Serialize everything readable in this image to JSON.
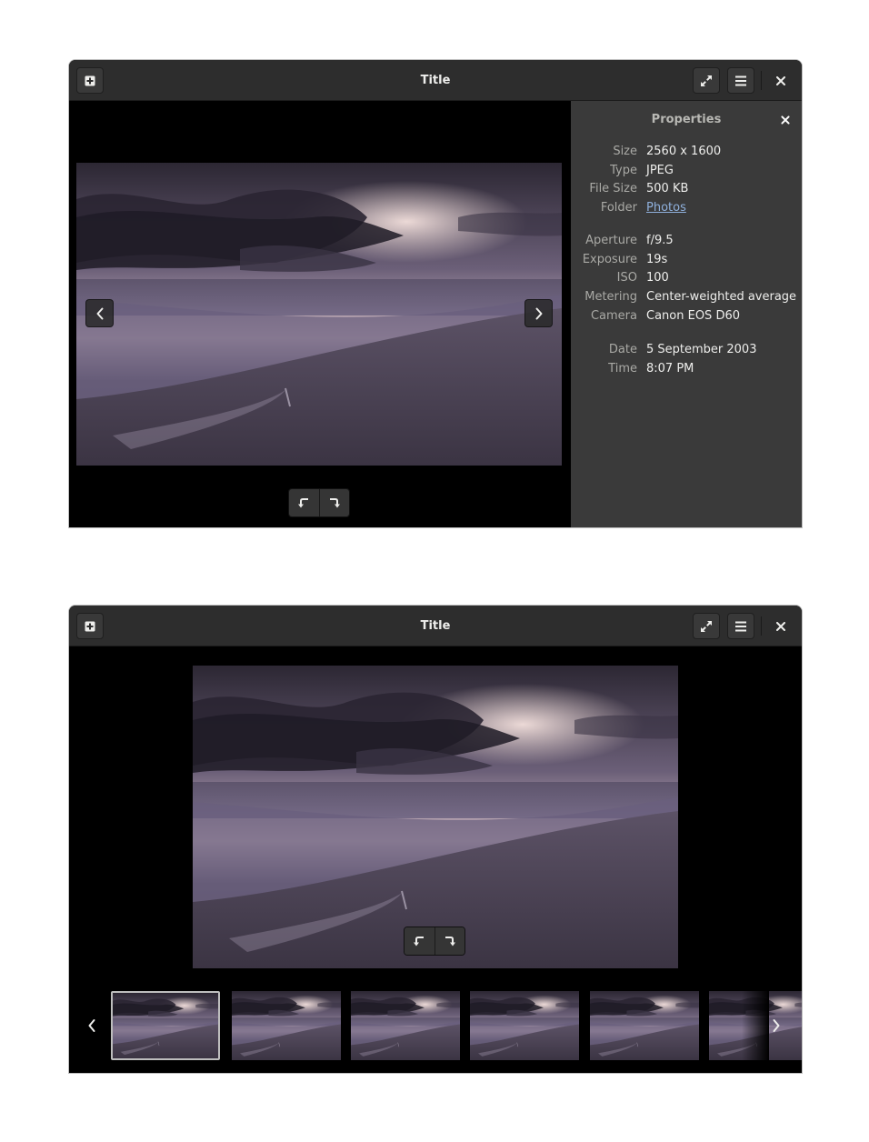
{
  "windows": [
    {
      "id": "properties-view",
      "title": "Title",
      "buttons": {
        "new_icon": "plus-box-icon",
        "fullscreen_icon": "fullscreen-icon",
        "menu_icon": "hamburger-menu-icon",
        "close_icon": "close-icon"
      },
      "viewer": {
        "prev_icon": "chevron-left-icon",
        "next_icon": "chevron-right-icon",
        "rotate_left_icon": "rotate-left-icon",
        "rotate_right_icon": "rotate-right-icon"
      },
      "properties": {
        "title": "Properties",
        "close_icon": "close-icon",
        "groups": [
          {
            "rows": [
              {
                "label": "Size",
                "value": "2560 x 1600"
              },
              {
                "label": "Type",
                "value": "JPEG"
              },
              {
                "label": "File Size",
                "value": "500 KB"
              },
              {
                "label": "Folder",
                "value": "Photos",
                "link": true
              }
            ]
          },
          {
            "rows": [
              {
                "label": "Aperture",
                "value": "f/9.5"
              },
              {
                "label": "Exposure",
                "value": "19s"
              },
              {
                "label": "ISO",
                "value": "100"
              },
              {
                "label": "Metering",
                "value": "Center-weighted average"
              },
              {
                "label": "Camera",
                "value": "Canon EOS D60"
              }
            ]
          },
          {
            "rows": [
              {
                "label": "Date",
                "value": "5 September 2003"
              },
              {
                "label": "Time",
                "value": "8:07 PM"
              }
            ]
          }
        ]
      }
    },
    {
      "id": "gallery-view",
      "title": "Title",
      "viewer": {
        "rotate_left_icon": "rotate-left-icon",
        "rotate_right_icon": "rotate-right-icon"
      },
      "thumbnail_strip": {
        "prev_icon": "chevron-left-icon",
        "next_icon": "chevron-right-icon",
        "thumbnail_count_visible": 6,
        "selected_index": 0
      }
    }
  ],
  "colors": {
    "titlebar": "#2d2d2d",
    "panel": "#3a3a3a",
    "link": "#8fb0dc"
  }
}
